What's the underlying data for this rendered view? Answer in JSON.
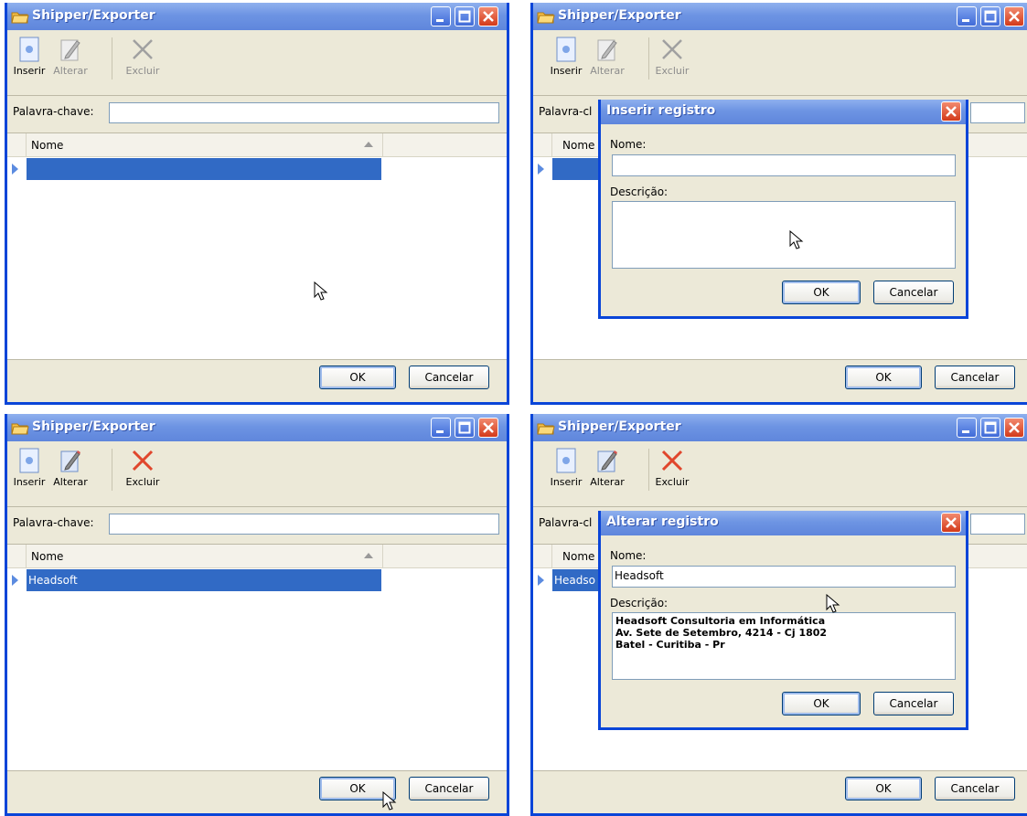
{
  "window": {
    "title": "Shipper/Exporter"
  },
  "toolbar": {
    "insert": "Inserir",
    "alter": "Alterar",
    "delete": "Excluir"
  },
  "filter": {
    "label": "Palavra-chave:",
    "value": ""
  },
  "grid": {
    "column": "Nome"
  },
  "footer": {
    "ok": "OK",
    "cancel": "Cancelar"
  },
  "panels": [
    {
      "row_value": ""
    },
    {
      "row_value": "",
      "dialog_title": "Inserir registro",
      "name_label": "Nome:",
      "name_value": "",
      "desc_label": "Descrição:",
      "desc_value": "",
      "ok": "OK",
      "cancel": "Cancelar",
      "clipped_label": "Palavra-cl",
      "clipped_column": "Nome"
    },
    {
      "row_value": "Headsoft"
    },
    {
      "row_value": "Headso",
      "dialog_title": "Alterar registro",
      "name_label": "Nome:",
      "name_value": "Headsoft",
      "desc_label": "Descrição:",
      "desc_value": "Headsoft Consultoria em Informática\nAv. Sete de Setembro, 4214 - Cj 1802\nBatel - Curitiba - Pr",
      "ok": "OK",
      "cancel": "Cancelar",
      "clipped_label": "Palavra-cl",
      "clipped_column": "Nome"
    }
  ],
  "colors": {
    "titlebar": "#6d94e3",
    "selection": "#316ac5",
    "frame": "#0a45d8",
    "face": "#ece9d8"
  }
}
